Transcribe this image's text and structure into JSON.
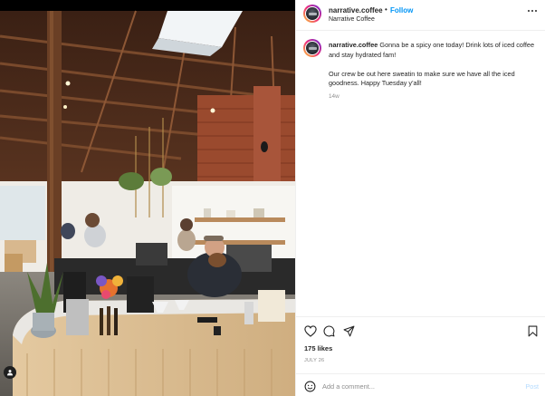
{
  "post": {
    "username": "narrative.coffee",
    "separator": "•",
    "follow_label": "Follow",
    "location": "Narrative Coffee",
    "caption_line1": "Gonna be a spicy one today! Drink lots of iced coffee and stay hydrated fam!",
    "caption_line2": "Our crew be out here sweatin to make sure we have all the iced goodness. Happy Tuesday y'all!",
    "time_ago": "14w",
    "likes": "175 likes",
    "date": "JULY 26",
    "comment_placeholder": "Add a comment...",
    "post_label": "Post"
  },
  "icons": {
    "options": "more-horizontal-icon",
    "like": "heart-icon",
    "comment": "comment-bubble-icon",
    "share": "paper-plane-icon",
    "save": "bookmark-icon",
    "emoji": "smiley-icon",
    "tags": "user-tag-icon"
  },
  "colors": {
    "accent": "#0095f6",
    "post_disabled": "#b3dbff",
    "secondary_text": "#8e8e8e"
  }
}
